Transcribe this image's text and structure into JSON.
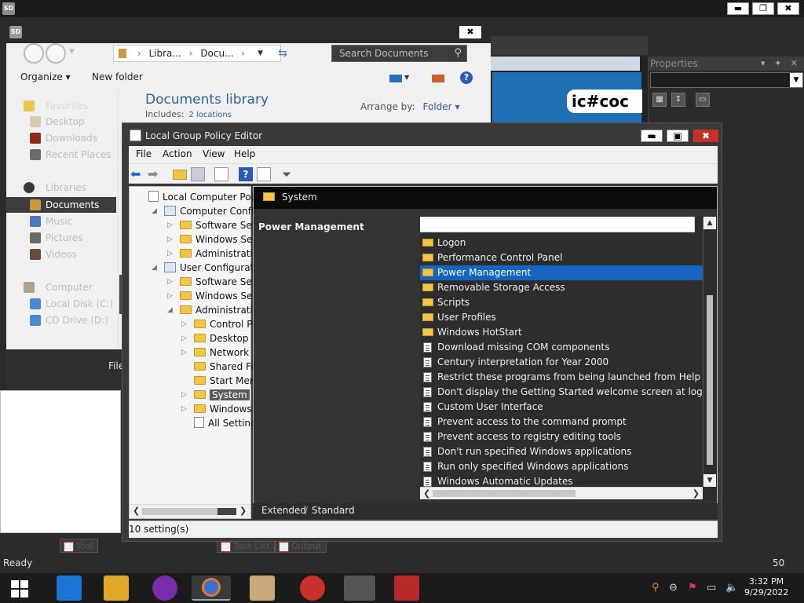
{
  "ide": {
    "logo_text": "SD",
    "title": "",
    "minimize": "▬",
    "restore": "❐",
    "close": "✖",
    "doc_banner": "ic#coc",
    "status_ready": "Ready",
    "status_num": "50",
    "bottom_tabs": [
      "Tool",
      "Task List",
      "Output"
    ]
  },
  "properties": {
    "title": "Properties",
    "header_buttons": "▾ ✦ ✕"
  },
  "explorer": {
    "logo_text": "SD",
    "close": "✖",
    "address": "Libra... › Docu... ›",
    "address_parts": [
      "Libra...",
      "Docu..."
    ],
    "search_placeholder": "Search Documents",
    "organize": "Organize",
    "new_folder": "New folder",
    "library_title": "Documents library",
    "includes_label": "Includes:",
    "includes_link": "2 locations",
    "arrange_label": "Arrange by:",
    "arrange_value": "Folder",
    "file_label": "File",
    "nav_items": [
      {
        "label": "Favorites",
        "selected": false
      },
      {
        "label": "Desktop",
        "selected": false
      },
      {
        "label": "Downloads",
        "selected": false
      },
      {
        "label": "Recent Places",
        "selected": false
      },
      {
        "label": "Libraries",
        "selected": false
      },
      {
        "label": "Documents",
        "selected": true
      },
      {
        "label": "Music",
        "selected": false
      },
      {
        "label": "Pictures",
        "selected": false
      },
      {
        "label": "Videos",
        "selected": false
      },
      {
        "label": "Computer",
        "selected": false
      },
      {
        "label": "Local Disk (C:)",
        "selected": false
      },
      {
        "label": "CD Drive (D:)",
        "selected": false
      }
    ]
  },
  "gpe": {
    "title": "Local Group Policy Editor",
    "minimize": "▬",
    "maximize": "▣",
    "close": "✖",
    "menu": [
      "File",
      "Action",
      "View",
      "Help"
    ],
    "tree": [
      {
        "label": "Local Computer Policy",
        "icon": "policy",
        "indent": 0,
        "expander": ""
      },
      {
        "label": "Computer Configura",
        "icon": "computer",
        "indent": 1,
        "expander": "◢"
      },
      {
        "label": "Software Settings",
        "icon": "folder",
        "indent": 2,
        "expander": "▷"
      },
      {
        "label": "Windows Setting",
        "icon": "folder",
        "indent": 2,
        "expander": "▷"
      },
      {
        "label": "Administrative Te",
        "icon": "folder",
        "indent": 2,
        "expander": "▷"
      },
      {
        "label": "User Configuration",
        "icon": "computer",
        "indent": 1,
        "expander": "◢"
      },
      {
        "label": "Software Settings",
        "icon": "folder",
        "indent": 2,
        "expander": "▷"
      },
      {
        "label": "Windows Setting",
        "icon": "folder",
        "indent": 2,
        "expander": "▷"
      },
      {
        "label": "Administrative Te",
        "icon": "folder",
        "indent": 2,
        "expander": "◢"
      },
      {
        "label": "Control Panel",
        "icon": "folder",
        "indent": 3,
        "expander": "▷"
      },
      {
        "label": "Desktop",
        "icon": "folder",
        "indent": 3,
        "expander": "▷"
      },
      {
        "label": "Network",
        "icon": "folder",
        "indent": 3,
        "expander": "▷"
      },
      {
        "label": "Shared Folder",
        "icon": "folder",
        "indent": 3,
        "expander": ""
      },
      {
        "label": "Start Menu ar",
        "icon": "folder",
        "indent": 3,
        "expander": ""
      },
      {
        "label": "System",
        "icon": "folder",
        "indent": 3,
        "expander": "▷",
        "selected": true
      },
      {
        "label": "Windows Cor",
        "icon": "folder",
        "indent": 3,
        "expander": "▷"
      },
      {
        "label": "All Settings",
        "icon": "policy",
        "indent": 3,
        "expander": ""
      }
    ],
    "header_title": "System",
    "description_title": "Power Management",
    "list_rows": [
      {
        "label": "Logon",
        "kind": "folder"
      },
      {
        "label": "Performance Control Panel",
        "kind": "folder"
      },
      {
        "label": "Power Management",
        "kind": "folder",
        "selected": true
      },
      {
        "label": "Removable Storage Access",
        "kind": "folder"
      },
      {
        "label": "Scripts",
        "kind": "folder"
      },
      {
        "label": "User Profiles",
        "kind": "folder"
      },
      {
        "label": "Windows HotStart",
        "kind": "folder"
      },
      {
        "label": "Download missing COM components",
        "kind": "setting"
      },
      {
        "label": "Century interpretation for Year 2000",
        "kind": "setting"
      },
      {
        "label": "Restrict these programs from being launched from Help",
        "kind": "setting"
      },
      {
        "label": "Don't display the Getting Started welcome screen at logon",
        "kind": "setting"
      },
      {
        "label": "Custom User Interface",
        "kind": "setting"
      },
      {
        "label": "Prevent access to the command prompt",
        "kind": "setting"
      },
      {
        "label": "Prevent access to registry editing tools",
        "kind": "setting"
      },
      {
        "label": "Don't run specified Windows applications",
        "kind": "setting"
      },
      {
        "label": "Run only specified Windows applications",
        "kind": "setting"
      },
      {
        "label": "Windows Automatic Updates",
        "kind": "setting"
      }
    ],
    "tab_extended": "Extended",
    "tab_standard": "Standard",
    "status": "10 setting(s)"
  },
  "taskbar": {
    "time": "3:32 PM",
    "date": "9/29/2022",
    "apps": [
      "file-manager-icon",
      "file-explorer-icon",
      "yahoo-messenger-icon",
      "firefox-icon",
      "app-icon",
      "angry-birds-icon",
      "sharpdevelop-icon",
      "toolbox-icon"
    ]
  },
  "colors": {
    "selection": "#1565c0",
    "folder": "#f0c64a",
    "close_red": "#c8302a",
    "link_blue": "#2d62a3"
  }
}
